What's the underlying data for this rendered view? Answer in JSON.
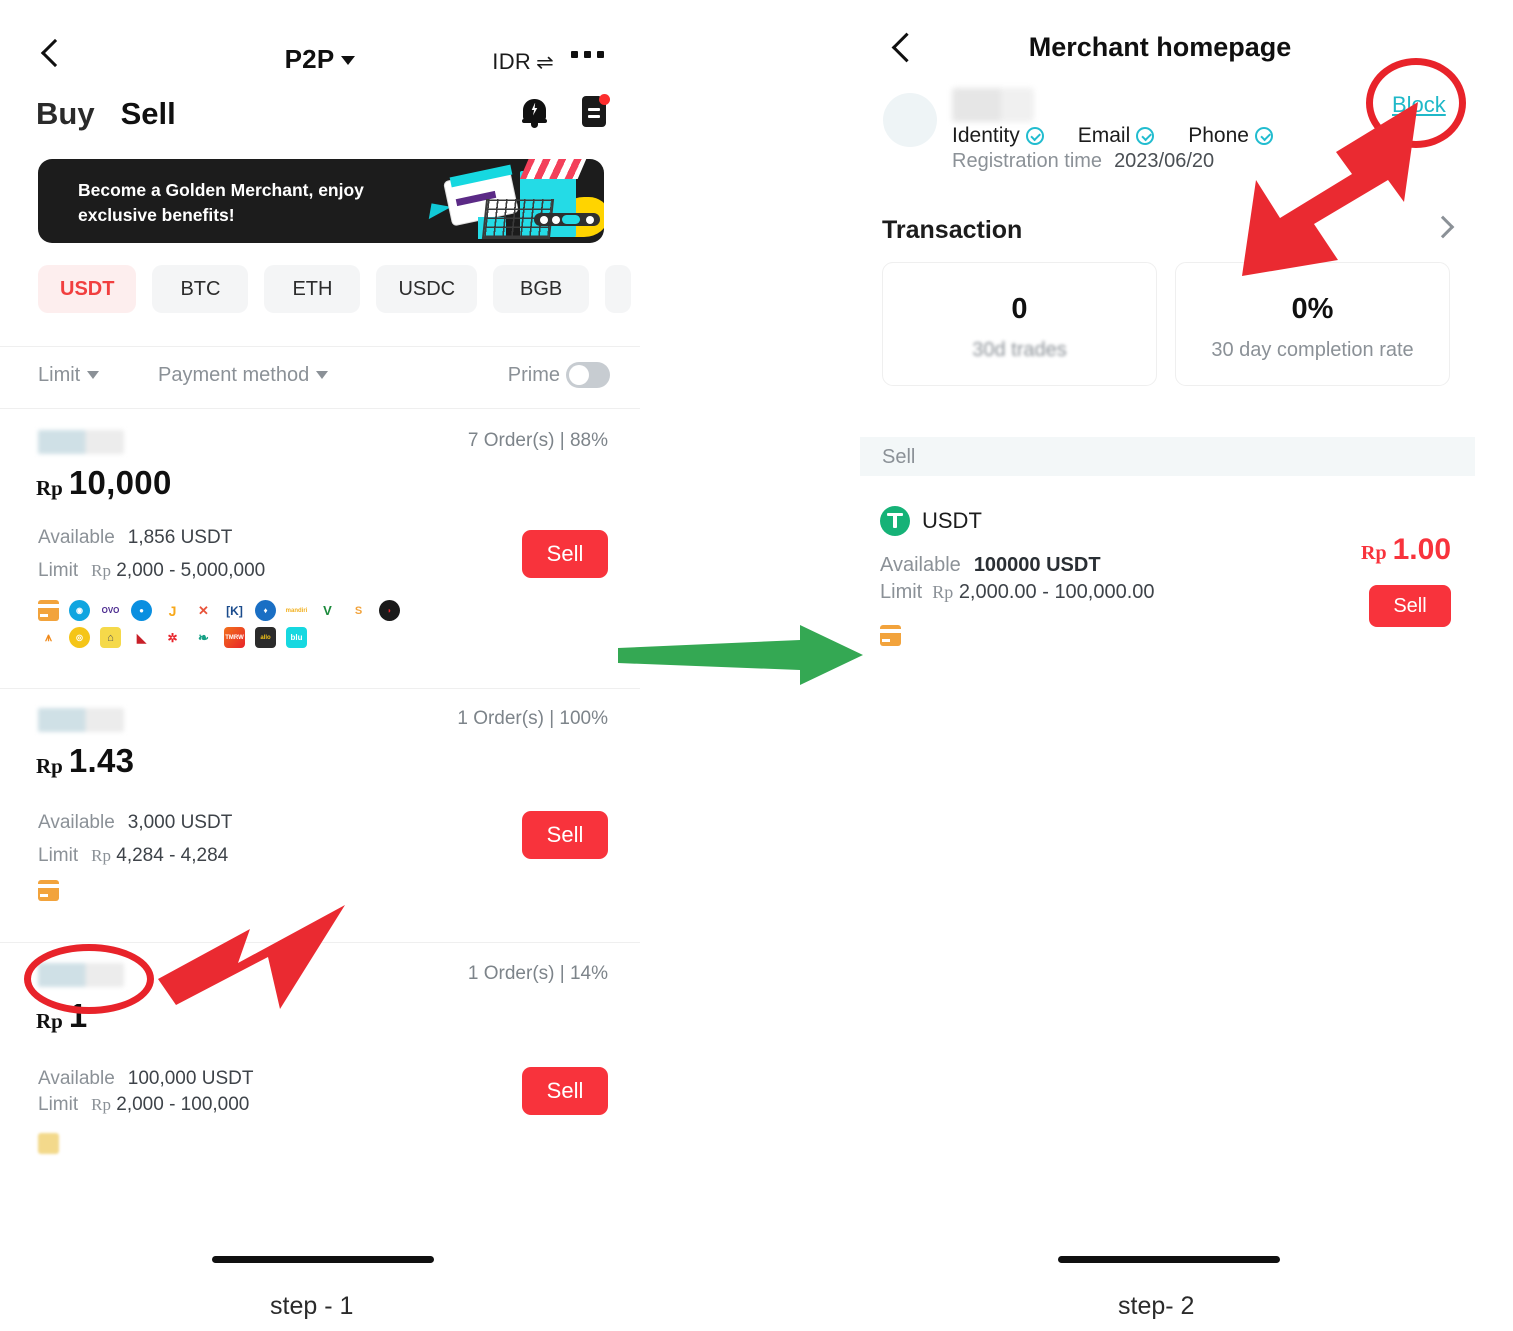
{
  "left": {
    "nav": {
      "back_icon": "chevron-left-icon",
      "title": "P2P",
      "currency": "IDR",
      "swap_icon": "⇌",
      "more_icon": "ellipsis-icon"
    },
    "tabs": [
      {
        "label": "Buy"
      },
      {
        "label": "Sell"
      }
    ],
    "header_icons": [
      {
        "name": "notification-bell-icon"
      },
      {
        "name": "order-document-icon"
      }
    ],
    "promo": {
      "text": "Become a Golden Merchant, enjoy exclusive benefits!"
    },
    "coins": [
      {
        "label": "USDT",
        "active": true
      },
      {
        "label": "BTC",
        "active": false
      },
      {
        "label": "ETH",
        "active": false
      },
      {
        "label": "USDC",
        "active": false
      },
      {
        "label": "BGB",
        "active": false
      },
      {
        "label": "",
        "active": false
      }
    ],
    "filters": {
      "limit_label": "Limit",
      "payment_label": "Payment method",
      "prime_label": "Prime",
      "prime_on": false
    },
    "offers": [
      {
        "orders": "7 Order(s) | 88%",
        "currency_symbol": "Rp",
        "price": "10,000",
        "available_key": "Available",
        "available_value": "1,856 USDT",
        "limit_key": "Limit",
        "limit_symbol": "Rp",
        "limit_value": "2,000 - 5,000,000",
        "action": "Sell",
        "payment_count": 20
      },
      {
        "orders": "1 Order(s) | 100%",
        "currency_symbol": "Rp",
        "price": "1.43",
        "available_key": "Available",
        "available_value": "3,000 USDT",
        "limit_key": "Limit",
        "limit_symbol": "Rp",
        "limit_value": "4,284 - 4,284",
        "action": "Sell",
        "payment_count": 1
      },
      {
        "orders": "1 Order(s) | 14%",
        "currency_symbol": "Rp",
        "price": "1",
        "available_key": "Available",
        "available_value": "100,000 USDT",
        "limit_key": "Limit",
        "limit_symbol": "Rp",
        "limit_value": "2,000 - 100,000",
        "action": "Sell",
        "payment_count": 1
      }
    ]
  },
  "right": {
    "nav": {
      "back_icon": "chevron-left-icon",
      "title": "Merchant homepage"
    },
    "merchant": {
      "verifications": [
        {
          "label": "Identity"
        },
        {
          "label": "Email"
        },
        {
          "label": "Phone"
        }
      ],
      "registration_key": "Registration time",
      "registration_value": "2023/06/20",
      "block_label": "Block"
    },
    "transaction": {
      "section_label": "Transaction",
      "stats": [
        {
          "value": "0",
          "label": "30d trades",
          "blurred": true
        },
        {
          "value": "0%",
          "label": "30 day completion rate",
          "blurred": false
        }
      ]
    },
    "sell_section": {
      "header": "Sell",
      "coin": "USDT",
      "available_key": "Available",
      "available_value": "100000 USDT",
      "limit_key": "Limit",
      "limit_symbol": "Rp",
      "limit_value": "2,000.00 - 100,000.00",
      "price_symbol": "Rp",
      "price": "1.00",
      "action": "Sell"
    }
  },
  "steps": [
    {
      "label": "step - 1"
    },
    {
      "label": "step- 2"
    }
  ],
  "colors": {
    "accent_red": "#f8333c",
    "annotation_red": "#e8232a",
    "annotation_green": "#34a853",
    "link_teal": "#1fb8c8",
    "usdt_green": "#15b277"
  }
}
